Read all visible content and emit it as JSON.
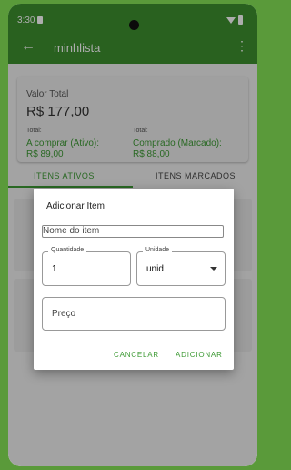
{
  "status_bar": {
    "time": "3:30"
  },
  "app_bar": {
    "title": "minhlista",
    "back_icon": "arrow-left-icon",
    "menu_icon": "more-vert-icon"
  },
  "summary": {
    "total_label": "Valor Total",
    "total_value": "R$ 177,00",
    "left_small": "Total:",
    "left_label": "A comprar (Ativo):",
    "left_value": "R$ 89,00",
    "right_small": "Total:",
    "right_label": "Comprado (Marcado):",
    "right_value": "R$ 88,00"
  },
  "tabs": [
    {
      "label": "ITENS ATIVOS",
      "active": true
    },
    {
      "label": "ITENS MARCADOS",
      "active": false
    }
  ],
  "dialog": {
    "title": "Adicionar Item",
    "name_placeholder": "Nome do item",
    "quantity_label": "Quantidade",
    "quantity_value": "1",
    "unit_label": "Unidade",
    "unit_value": "unid",
    "price_placeholder": "Preço",
    "cancel_label": "CANCELAR",
    "add_label": "ADICIONAR"
  },
  "colors": {
    "primary": "#3d8f2f",
    "accent": "#3d9a34"
  }
}
